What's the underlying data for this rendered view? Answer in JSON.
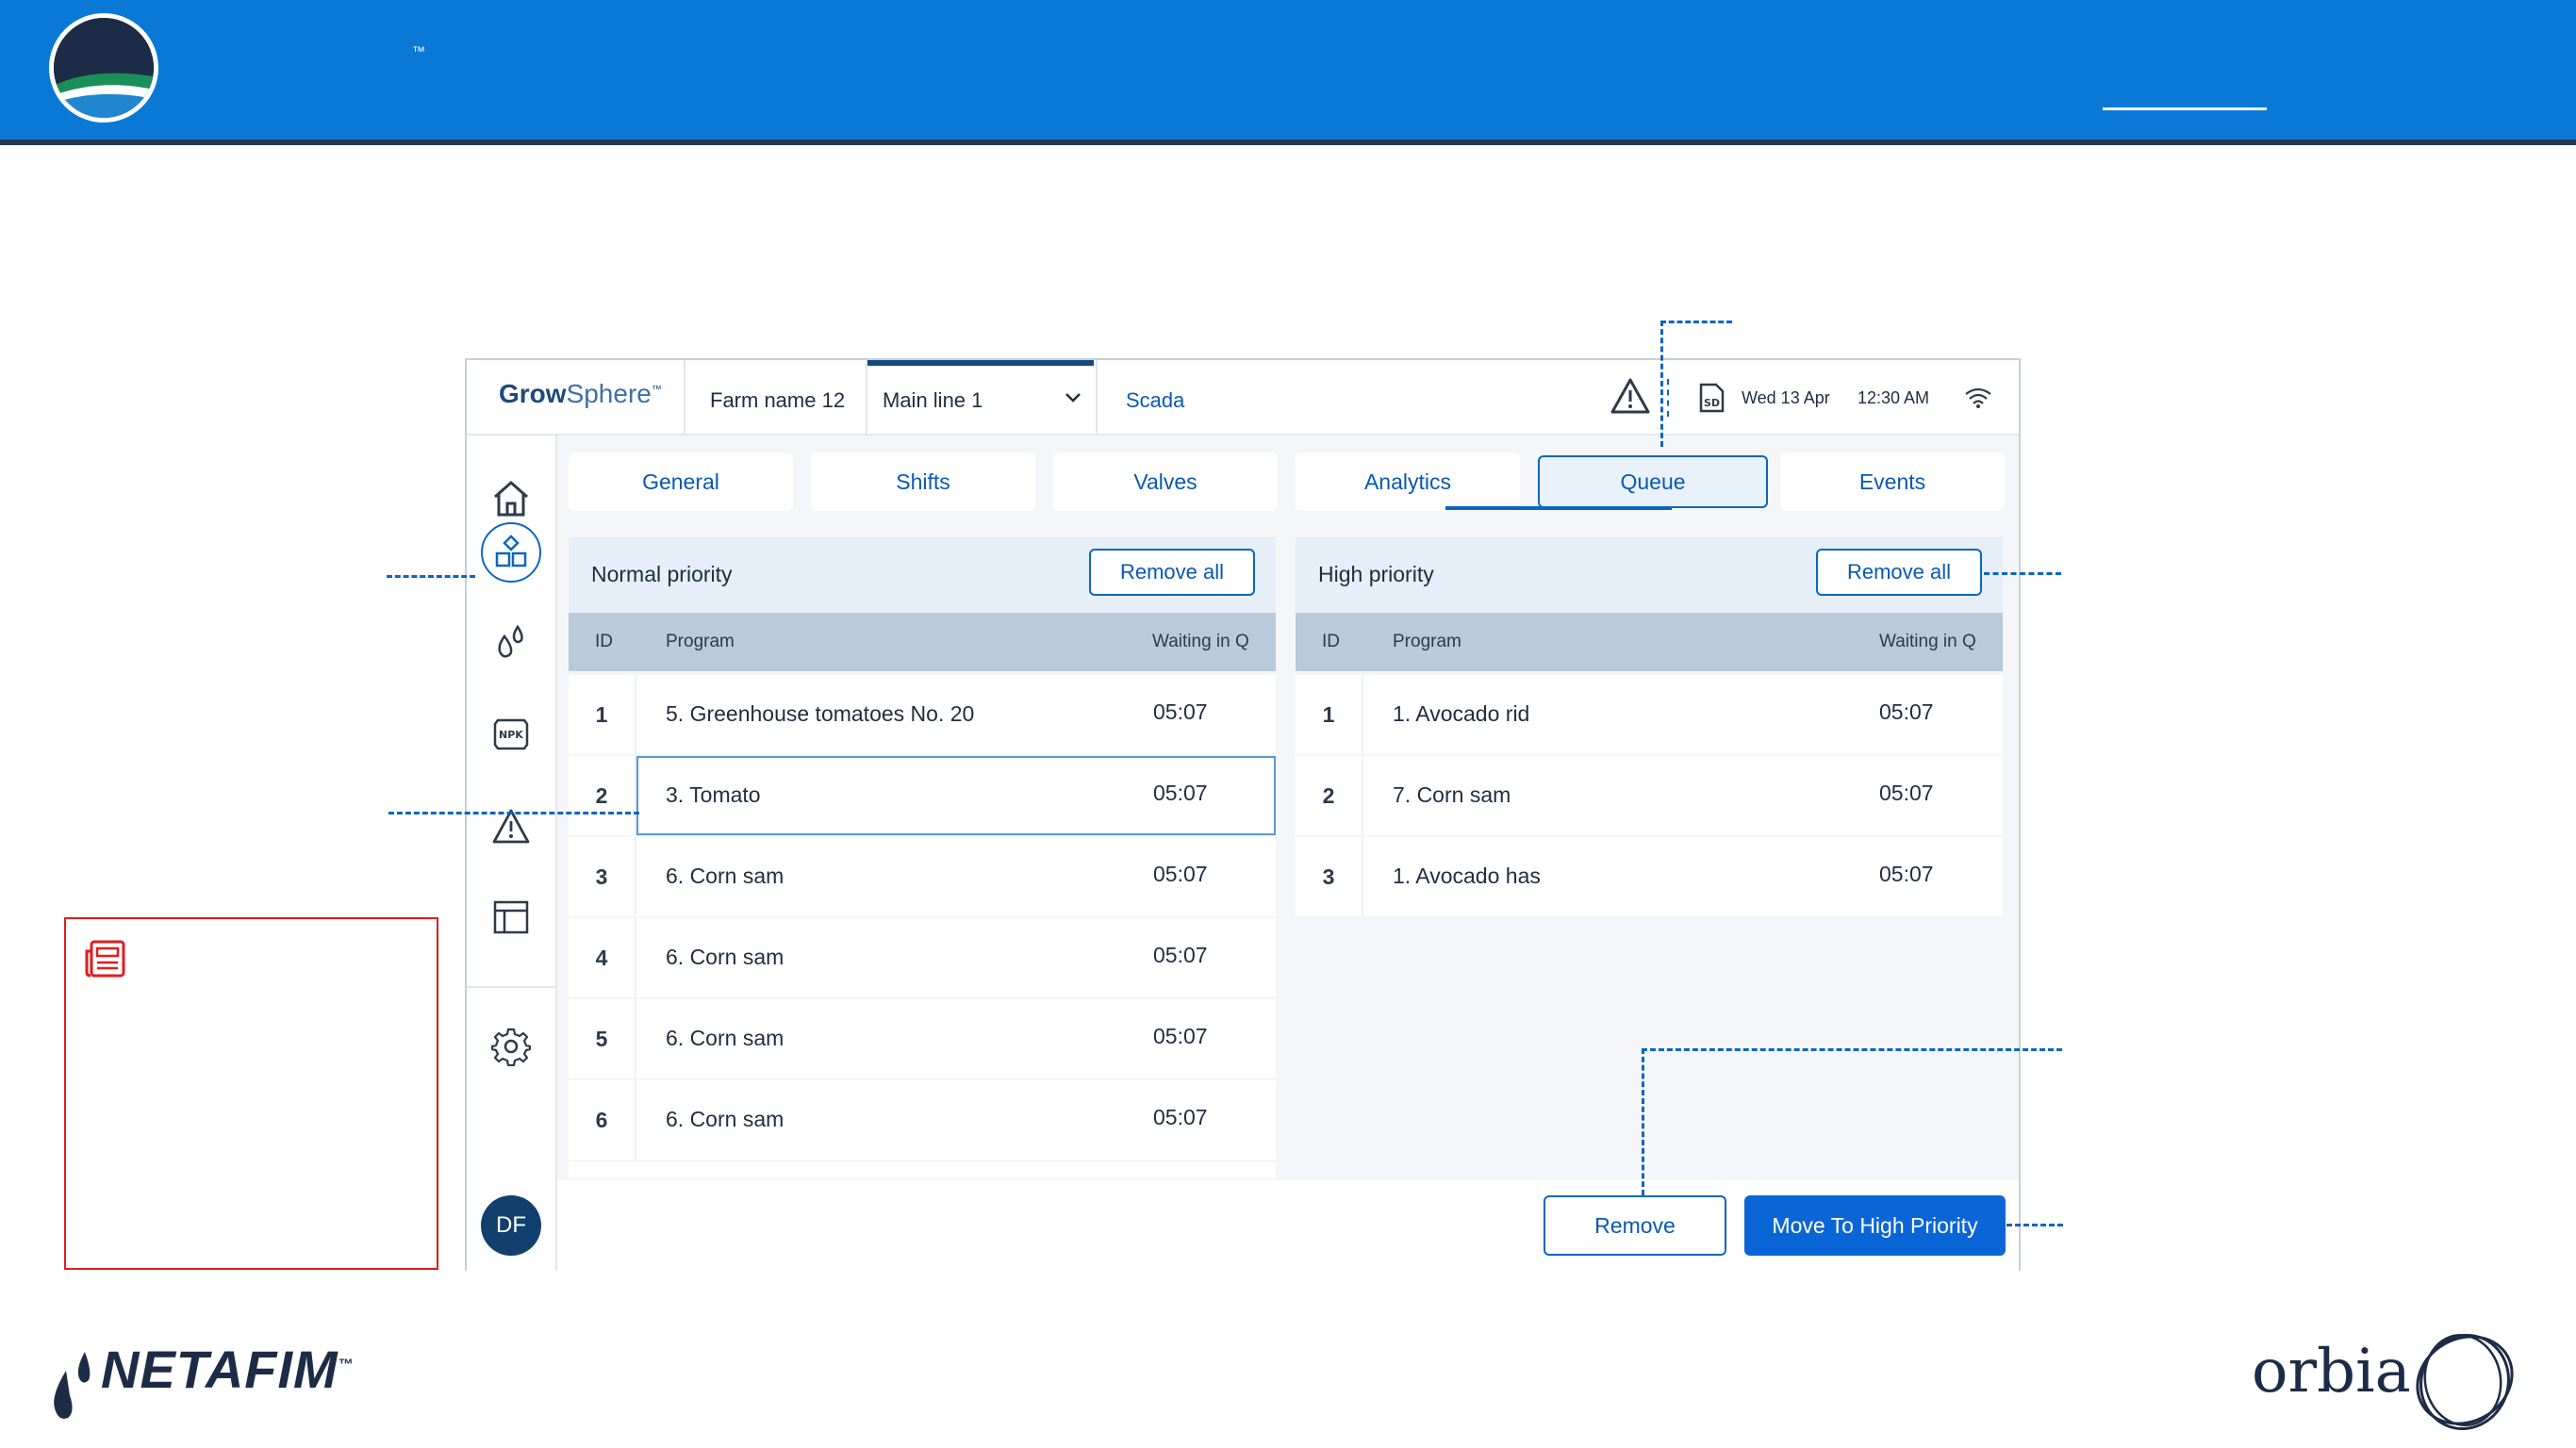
{
  "banner": {
    "trademark": "™"
  },
  "app": {
    "brand": {
      "bold": "Grow",
      "rest": "Sphere",
      "tm": "™"
    },
    "farm": "Farm name 12",
    "main_line": "Main line 1",
    "scada": "Scada",
    "sd_label": "SD",
    "date": "Wed 13 Apr",
    "time": "12:30 AM",
    "avatar": "DF"
  },
  "tabs": [
    {
      "label": "General"
    },
    {
      "label": "Shifts"
    },
    {
      "label": "Valves"
    },
    {
      "label": "Analytics"
    },
    {
      "label": "Queue"
    },
    {
      "label": "Events"
    }
  ],
  "normal": {
    "title": "Normal priority",
    "remove_all": "Remove all",
    "col_id": "ID",
    "col_program": "Program",
    "col_wait": "Waiting in Q",
    "rows": [
      {
        "id": "1",
        "program": "5. Greenhouse tomatoes No. 20",
        "wait": "05:07"
      },
      {
        "id": "2",
        "program": "3. Tomato",
        "wait": "05:07"
      },
      {
        "id": "3",
        "program": "6. Corn sam",
        "wait": "05:07"
      },
      {
        "id": "4",
        "program": "6. Corn sam",
        "wait": "05:07"
      },
      {
        "id": "5",
        "program": "6. Corn sam",
        "wait": "05:07"
      },
      {
        "id": "6",
        "program": "6. Corn sam",
        "wait": "05:07"
      }
    ]
  },
  "high": {
    "title": "High priority",
    "remove_all": "Remove all",
    "col_id": "ID",
    "col_program": "Program",
    "col_wait": "Waiting in Q",
    "rows": [
      {
        "id": "1",
        "program": "1. Avocado rid",
        "wait": "05:07"
      },
      {
        "id": "2",
        "program": "7. Corn sam",
        "wait": "05:07"
      },
      {
        "id": "3",
        "program": "1. Avocado has",
        "wait": "05:07"
      }
    ]
  },
  "actions": {
    "remove": "Remove",
    "move_high": "Move To High Priority"
  },
  "footer": {
    "netafim": "NETAFIM",
    "netafim_tm": "™",
    "orbia": "orbia"
  },
  "colors": {
    "banner": "#0a79d6",
    "accent": "#0a66c2",
    "primary_button": "#0a66d6",
    "note_border": "#e01d1d"
  }
}
